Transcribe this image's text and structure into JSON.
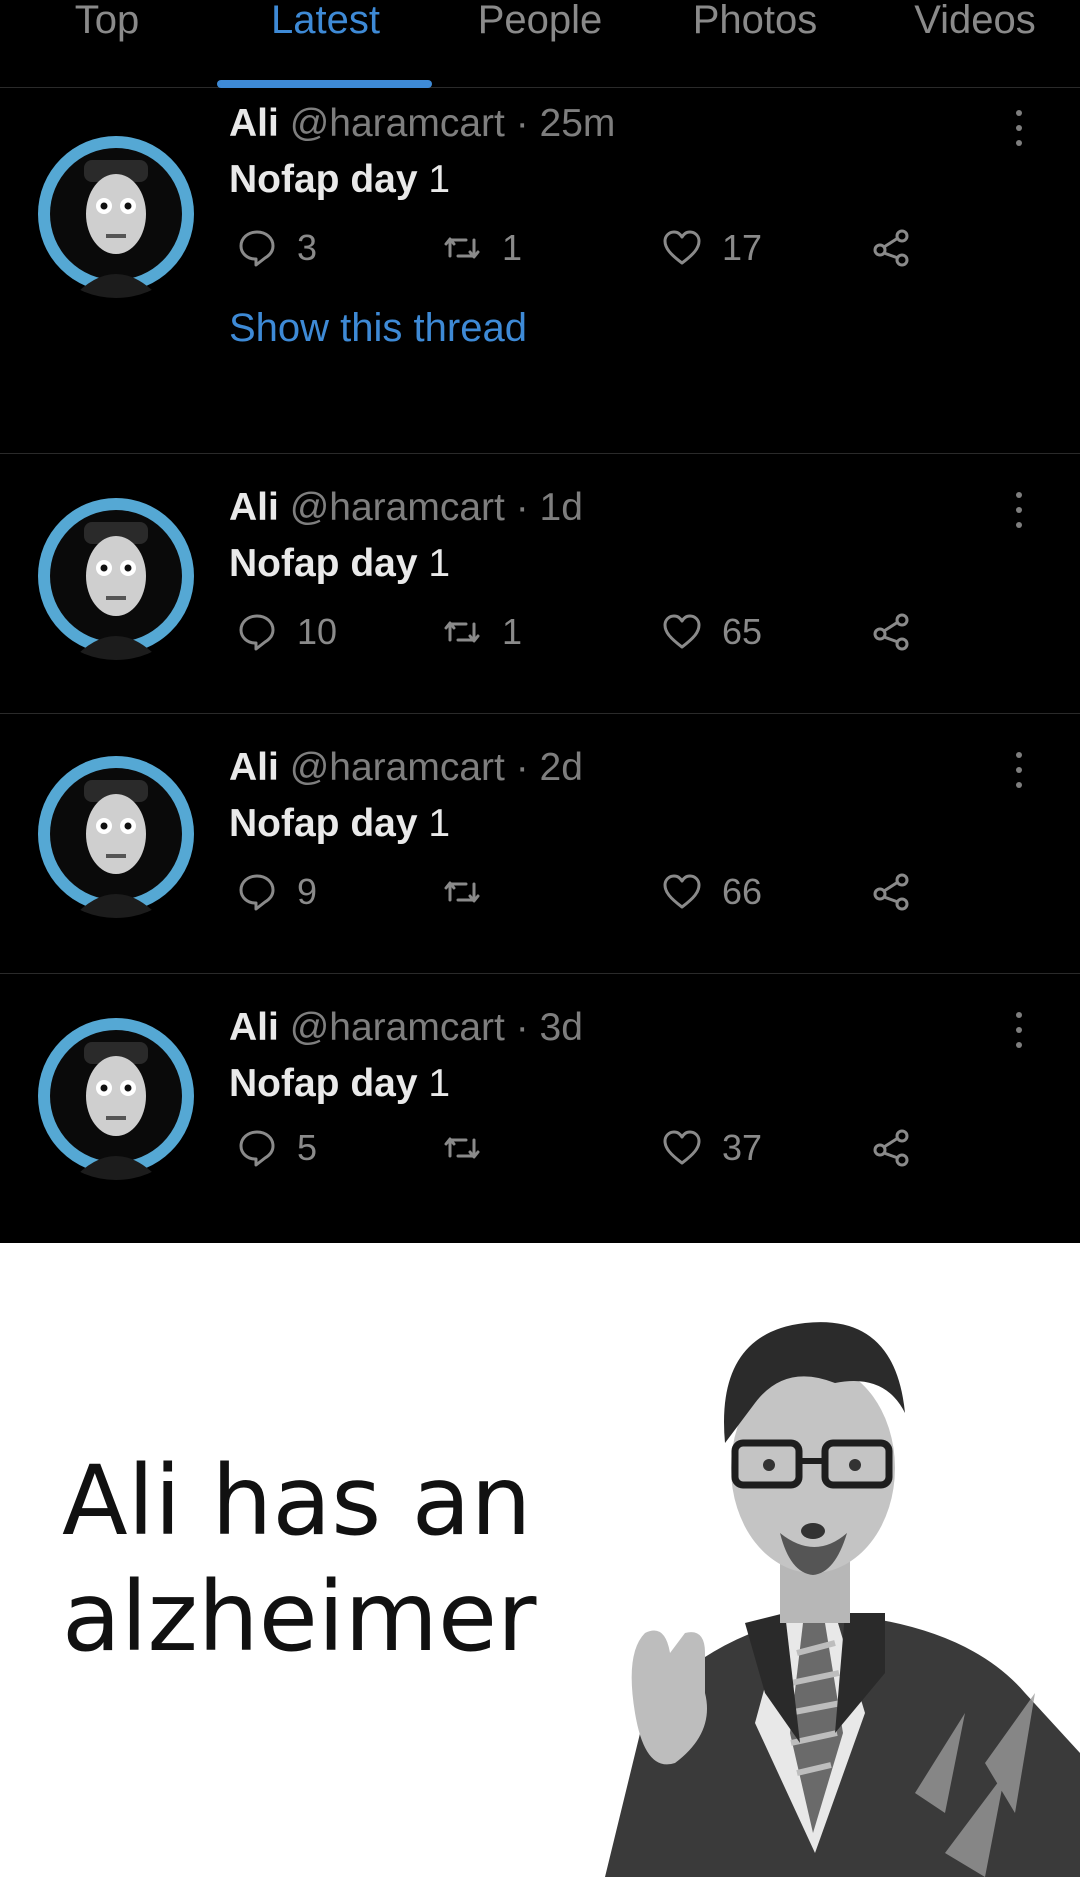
{
  "tabs": [
    {
      "label": "Top",
      "active": false
    },
    {
      "label": "Latest",
      "active": true
    },
    {
      "label": "People",
      "active": false
    },
    {
      "label": "Photos",
      "active": false
    },
    {
      "label": "Videos",
      "active": false
    }
  ],
  "colors": {
    "accent": "#3e8ad6",
    "background": "#000000",
    "muted": "#7e7e7e",
    "text": "#e9e9e9",
    "meme_background": "#ffffff"
  },
  "tweets": [
    {
      "name": "Ali",
      "handle": "@haramcart",
      "separator": "·",
      "time": "25m",
      "text_bold": "Nofap day",
      "text_rest": " 1",
      "replies": "3",
      "retweets": "1",
      "likes": "17",
      "show_thread": "Show this thread"
    },
    {
      "name": "Ali",
      "handle": "@haramcart",
      "separator": "·",
      "time": "1d",
      "text_bold": "Nofap day",
      "text_rest": " 1",
      "replies": "10",
      "retweets": "1",
      "likes": "65"
    },
    {
      "name": "Ali",
      "handle": "@haramcart",
      "separator": "·",
      "time": "2d",
      "text_bold": "Nofap day",
      "text_rest": " 1",
      "replies": "9",
      "retweets": "",
      "likes": "66"
    },
    {
      "name": "Ali",
      "handle": "@haramcart",
      "separator": "·",
      "time": "3d",
      "text_bold": "Nofap day",
      "text_rest": " 1",
      "replies": "5",
      "retweets": "",
      "likes": "37"
    }
  ],
  "icons": {
    "reply": "reply-icon",
    "retweet": "retweet-icon",
    "like": "heart-icon",
    "share": "share-icon",
    "more": "more-vertical-icon"
  },
  "meme": {
    "caption_line1": "Ali has an",
    "caption_line2": "alzheimer"
  }
}
